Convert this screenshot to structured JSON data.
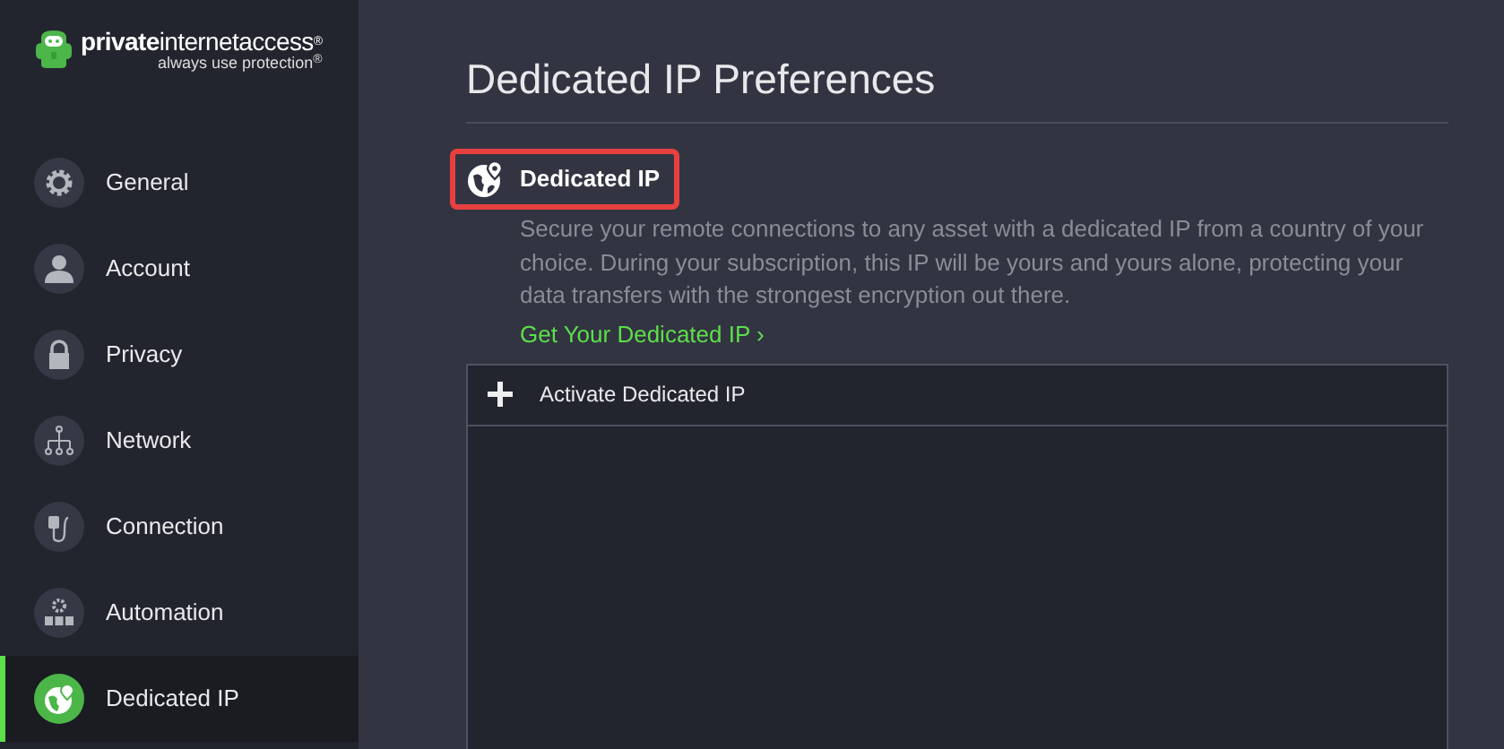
{
  "logo": {
    "name": "**private**internetaccess$^{®}$",
    "tagline": "always use protection$^{®}$"
  },
  "sidebar": {
    "items": [
      {
        "label": "General",
        "kind": "gear",
        "selected": false
      },
      {
        "label": "Account",
        "kind": "person",
        "selected": false
      },
      {
        "label": "Privacy",
        "kind": "lock",
        "selected": false
      },
      {
        "label": "Network",
        "kind": "network",
        "selected": false
      },
      {
        "label": "Connection",
        "kind": "plug",
        "selected": false
      },
      {
        "label": "Automation",
        "kind": "automation",
        "selected": false
      },
      {
        "label": "Dedicated IP",
        "kind": "globe",
        "selected": true
      }
    ]
  },
  "page": {
    "title": "Dedicated IP Preferences",
    "section": {
      "heading": "Dedicated IP",
      "highlighted": true,
      "description": "Secure your remote connections to any asset with a dedicated IP from a country of your choice. During your subscription, this IP will be yours and yours alone, protecting your data transfers with the strongest encryption out there.",
      "link": "Get Your Dedicated IP ›"
    },
    "panel": {
      "action": "Activate Dedicated IP"
    }
  }
}
